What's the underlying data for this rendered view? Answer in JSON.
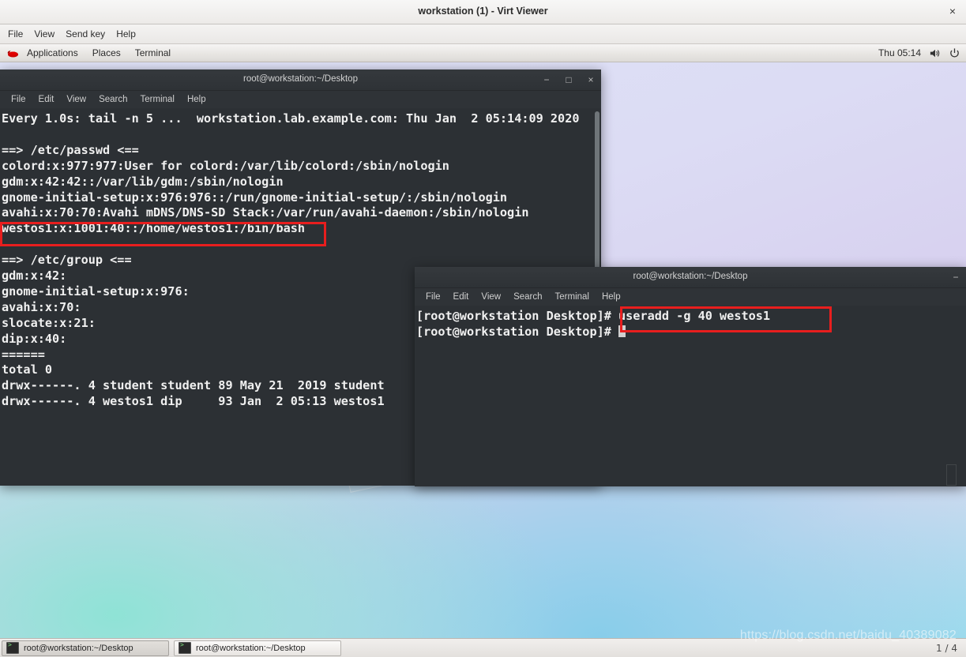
{
  "window": {
    "title": "workstation (1) - Virt Viewer",
    "close_label": "×",
    "menu": [
      "File",
      "View",
      "Send key",
      "Help"
    ]
  },
  "gnome_panel": {
    "logo_icon": "redhat-logo-icon",
    "items": [
      "Applications",
      "Places",
      "Terminal"
    ],
    "clock": "Thu 05:14",
    "volume_icon": "volume-icon",
    "power_icon": "power-icon"
  },
  "terminal1": {
    "title": "root@workstation:~/Desktop",
    "menu": [
      "File",
      "Edit",
      "View",
      "Search",
      "Terminal",
      "Help"
    ],
    "buttons": {
      "minimize": "−",
      "maximize": "□",
      "close": "×"
    },
    "lines": [
      "Every 1.0s: tail -n 5 ...  workstation.lab.example.com: Thu Jan  2 05:14:09 2020",
      "",
      "==> /etc/passwd <==",
      "colord:x:977:977:User for colord:/var/lib/colord:/sbin/nologin",
      "gdm:x:42:42::/var/lib/gdm:/sbin/nologin",
      "gnome-initial-setup:x:976:976::/run/gnome-initial-setup/:/sbin/nologin",
      "avahi:x:70:70:Avahi mDNS/DNS-SD Stack:/var/run/avahi-daemon:/sbin/nologin",
      "westos1:x:1001:40::/home/westos1:/bin/bash",
      "",
      "==> /etc/group <==",
      "gdm:x:42:",
      "gnome-initial-setup:x:976:",
      "avahi:x:70:",
      "slocate:x:21:",
      "dip:x:40:",
      "======",
      "total 0",
      "drwx------. 4 student student 89 May 21  2019 student",
      "drwx------. 4 westos1 dip     93 Jan  2 05:13 westos1"
    ],
    "highlight_note": "westos1:x:1001:40::/home/westos1:/bin/bash"
  },
  "terminal2": {
    "title": "root@workstation:~/Desktop",
    "menu": [
      "File",
      "Edit",
      "View",
      "Search",
      "Terminal",
      "Help"
    ],
    "buttons": {
      "minimize": "−"
    },
    "prompt": "[root@workstation Desktop]# ",
    "command": "useradd -g 40 westos1",
    "lines": [
      "[root@workstation Desktop]# useradd -g 40 westos1",
      "[root@workstation Desktop]# "
    ],
    "highlight_note": "useradd -g 40 westos1"
  },
  "taskbar": {
    "items": [
      {
        "label": "root@workstation:~/Desktop",
        "icon": "terminal-icon"
      },
      {
        "label": "root@workstation:~/Desktop",
        "icon": "terminal-icon"
      }
    ],
    "page_indicator": "1 / 4"
  },
  "watermark": "https://blog.csdn.net/baidu_40389082",
  "colors": {
    "annotation_red": "#e81e1e",
    "terminal_bg": "#2c3034",
    "terminal_fg": "#f0f0f0"
  }
}
